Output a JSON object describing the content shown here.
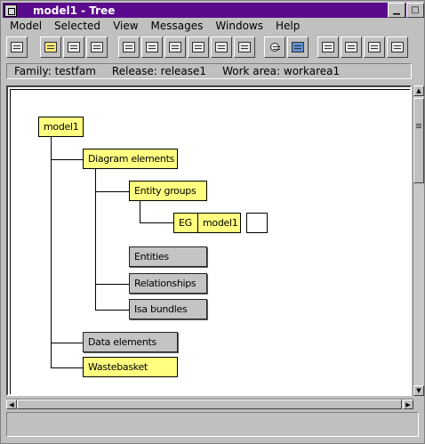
{
  "window": {
    "title": "model1 - Tree",
    "controls": {
      "minimize": "▁",
      "maximize": "□"
    }
  },
  "menu": [
    "Model",
    "Selected",
    "View",
    "Messages",
    "Windows",
    "Help"
  ],
  "toolbar": {
    "buttons": [
      "print-icon",
      "open-icon",
      "cut-icon",
      "copy-icon",
      "new-document-icon",
      "new-document-2-icon",
      "list-icon",
      "list-2-icon",
      "window-icon",
      "window-2-icon",
      "find-icon",
      "view-window-icon",
      "format-1-icon",
      "format-2-icon",
      "format-3-icon",
      "format-4-icon"
    ]
  },
  "info": {
    "family": "Family: testfam",
    "release": "Release: release1",
    "workarea": "Work area: workarea1"
  },
  "tree": {
    "root": "model1",
    "diagram_elements": "Diagram elements",
    "entity_groups": "Entity groups",
    "eg_prefix": "EG",
    "eg_model": "model1",
    "entities": "Entities",
    "relationships": "Relationships",
    "isa_bundles": "Isa bundles",
    "data_elements": "Data elements",
    "wastebasket": "Wastebasket"
  },
  "colors": {
    "titlebar": "#5a0a8c",
    "node_yellow": "#ffff80",
    "node_gray": "#c4c4c4"
  }
}
